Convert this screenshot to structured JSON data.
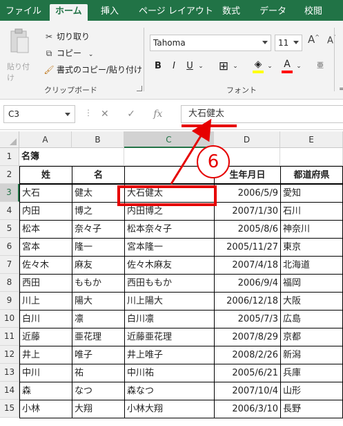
{
  "ribbon": {
    "tabs": [
      "ファイル",
      "ホーム",
      "挿入",
      "ページ レイアウト",
      "数式",
      "データ",
      "校閲"
    ],
    "active_tab": "ホーム",
    "clipboard": {
      "paste_label": "貼り付け",
      "cut_label": "切り取り",
      "copy_label": "コピー",
      "format_painter_label": "書式のコピー/貼り付け",
      "group_label": "クリップボード"
    },
    "font": {
      "font_name": "Tahoma",
      "font_size": "11",
      "group_label": "フォント"
    }
  },
  "formula_bar": {
    "name_box": "C3",
    "content": "大石健太"
  },
  "callout": {
    "number": "6"
  },
  "sheet": {
    "columns": [
      "A",
      "B",
      "C",
      "D",
      "E"
    ],
    "selected_column": "C",
    "selected_row": "3",
    "title": "名簿",
    "headers": {
      "A": "姓",
      "B": "名",
      "C": "",
      "D": "生年月日",
      "E": "都道府県"
    },
    "rows": [
      {
        "row": "3",
        "sei": "大石",
        "mei": "健太",
        "full": "大石健太",
        "birth": "2006/5/9",
        "pref": "愛知"
      },
      {
        "row": "4",
        "sei": "内田",
        "mei": "博之",
        "full": "内田博之",
        "birth": "2007/1/30",
        "pref": "石川"
      },
      {
        "row": "5",
        "sei": "松本",
        "mei": "奈々子",
        "full": "松本奈々子",
        "birth": "2005/8/6",
        "pref": "神奈川"
      },
      {
        "row": "6",
        "sei": "宮本",
        "mei": "隆一",
        "full": "宮本隆一",
        "birth": "2005/11/27",
        "pref": "東京"
      },
      {
        "row": "7",
        "sei": "佐々木",
        "mei": "麻友",
        "full": "佐々木麻友",
        "birth": "2007/4/18",
        "pref": "北海道"
      },
      {
        "row": "8",
        "sei": "西田",
        "mei": "ももか",
        "full": "西田ももか",
        "birth": "2006/9/4",
        "pref": "福岡"
      },
      {
        "row": "9",
        "sei": "川上",
        "mei": "陽大",
        "full": "川上陽大",
        "birth": "2006/12/18",
        "pref": "大阪"
      },
      {
        "row": "10",
        "sei": "白川",
        "mei": "凛",
        "full": "白川凛",
        "birth": "2005/7/3",
        "pref": "広島"
      },
      {
        "row": "11",
        "sei": "近藤",
        "mei": "亜花理",
        "full": "近藤亜花理",
        "birth": "2007/8/29",
        "pref": "京都"
      },
      {
        "row": "12",
        "sei": "井上",
        "mei": "唯子",
        "full": "井上唯子",
        "birth": "2008/2/26",
        "pref": "新潟"
      },
      {
        "row": "13",
        "sei": "中川",
        "mei": "祐",
        "full": "中川祐",
        "birth": "2005/6/21",
        "pref": "兵庫"
      },
      {
        "row": "14",
        "sei": "森",
        "mei": "なつ",
        "full": "森なつ",
        "birth": "2007/10/4",
        "pref": "山形"
      },
      {
        "row": "15",
        "sei": "小林",
        "mei": "大翔",
        "full": "小林大翔",
        "birth": "2006/3/10",
        "pref": "長野"
      }
    ]
  },
  "colors": {
    "excel_green": "#217346",
    "highlight_red": "#e60000",
    "fill_yellow": "#ffff00",
    "font_red": "#ff0000"
  }
}
